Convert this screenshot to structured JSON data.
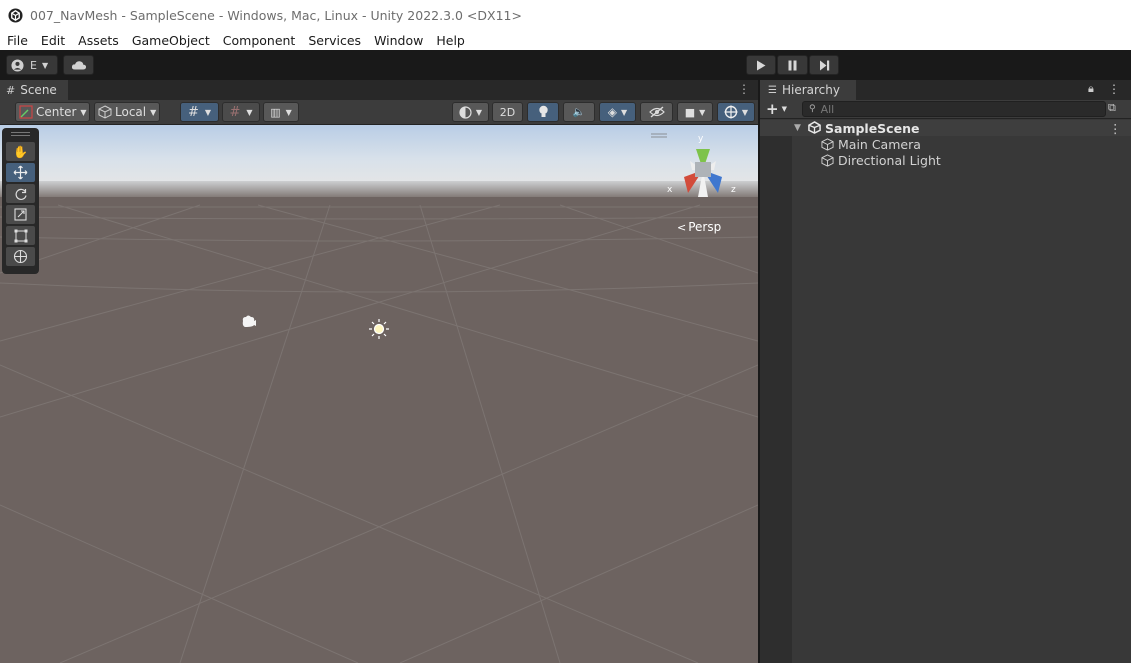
{
  "window": {
    "title": "007_NavMesh - SampleScene - Windows, Mac, Linux - Unity 2022.3.0 <DX11>"
  },
  "menu": [
    "File",
    "Edit",
    "Assets",
    "GameObject",
    "Component",
    "Services",
    "Window",
    "Help"
  ],
  "toolbar": {
    "account_label": "E"
  },
  "scene": {
    "tab_label": "Scene",
    "pivot_label": "Center",
    "space_label": "Local",
    "mode_2d_label": "2D",
    "projection_label": "Persp",
    "gizmo_axes": {
      "x": "x",
      "y": "y",
      "z": "z"
    }
  },
  "hierarchy": {
    "tab_label": "Hierarchy",
    "search_placeholder": "All",
    "scene_name": "SampleScene",
    "objects": [
      "Main Camera",
      "Directional Light"
    ]
  },
  "colors": {
    "accent_blue": "#46607c",
    "panel_dark": "#282828",
    "panel": "#383838"
  }
}
